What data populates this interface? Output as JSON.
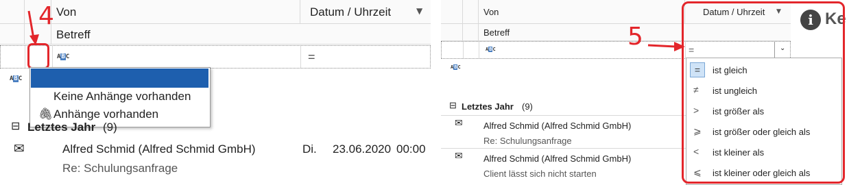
{
  "left": {
    "annotation_number": "4",
    "header": {
      "from_label": "Von",
      "date_label": "Datum / Uhrzeit",
      "subject_label": "Betreff"
    },
    "filter_row": {
      "abc_icon": "abc-filter-icon",
      "operator_symbol": "="
    },
    "dropdown": {
      "items": [
        {
          "label": ""
        },
        {
          "label": "Keine Anhänge vorhanden"
        },
        {
          "label": "Anhänge vorhanden",
          "icon": "paperclip-icon"
        }
      ]
    },
    "group": {
      "label": "Letztes Jahr",
      "count": "(9)"
    },
    "email": {
      "sender": "Alfred Schmid (Alfred Schmid GmbH)",
      "day": "Di.",
      "date": "23.06.2020",
      "time": "00:00",
      "subject": "Re: Schulungsanfrage"
    }
  },
  "right": {
    "annotation_number": "5",
    "header": {
      "from_label": "Von",
      "date_label": "Datum / Uhrzeit",
      "subject_label": "Betreff"
    },
    "filter_row": {
      "operator_value": "="
    },
    "info_label_partial": "Ke",
    "group": {
      "label": "Letztes Jahr",
      "count": "(9)"
    },
    "emails": [
      {
        "sender": "Alfred Schmid (Alfred Schmid GmbH)",
        "subject": "Re: Schulungsanfrage"
      },
      {
        "sender": "Alfred Schmid (Alfred Schmid GmbH)",
        "subject": "Client lässt sich nicht starten"
      }
    ],
    "operators": [
      {
        "symbol": "=",
        "label": "ist gleich",
        "selected": true
      },
      {
        "symbol": "≠",
        "label": "ist ungleich"
      },
      {
        "symbol": ">",
        "label": "ist größer als"
      },
      {
        "symbol": "⩾",
        "label": "ist größer oder gleich als"
      },
      {
        "symbol": "<",
        "label": "ist kleiner als"
      },
      {
        "symbol": "⩽",
        "label": "ist kleiner oder gleich als"
      }
    ]
  },
  "colors": {
    "highlight": "#e3262b",
    "selection": "#1e5fae",
    "border": "#d9d9d9",
    "info_icon": "#444444"
  }
}
